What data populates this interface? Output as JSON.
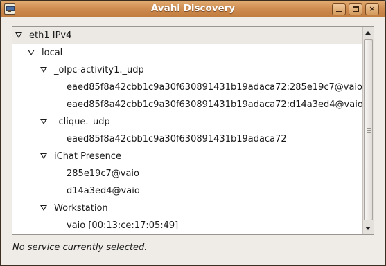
{
  "window": {
    "title": "Avahi Discovery",
    "app_icon": "avahi-network-icon",
    "controls": {
      "minimize": "minimize-icon",
      "maximize": "maximize-icon",
      "close": "×"
    }
  },
  "tree": {
    "rows": [
      {
        "label": "eth1 IPv4",
        "level": 0,
        "expanded": true,
        "selected": true
      },
      {
        "label": "local",
        "level": 1,
        "expanded": true
      },
      {
        "label": "_olpc-activity1._udp",
        "level": 2,
        "expanded": true
      },
      {
        "label": "eaed85f8a42cbb1c9a30f630891431b19adaca72:285e19c7@vaio",
        "level": 3
      },
      {
        "label": "eaed85f8a42cbb1c9a30f630891431b19adaca72:d14a3ed4@vaio",
        "level": 3
      },
      {
        "label": "_clique._udp",
        "level": 2,
        "expanded": true
      },
      {
        "label": "eaed85f8a42cbb1c9a30f630891431b19adaca72",
        "level": 3
      },
      {
        "label": "iChat Presence",
        "level": 2,
        "expanded": true
      },
      {
        "label": "285e19c7@vaio",
        "level": 3
      },
      {
        "label": "d14a3ed4@vaio",
        "level": 3
      },
      {
        "label": "Workstation",
        "level": 2,
        "expanded": true
      },
      {
        "label": "vaio [00:13:ce:17:05:49]",
        "level": 3
      }
    ]
  },
  "status": {
    "text": "No service currently selected."
  }
}
